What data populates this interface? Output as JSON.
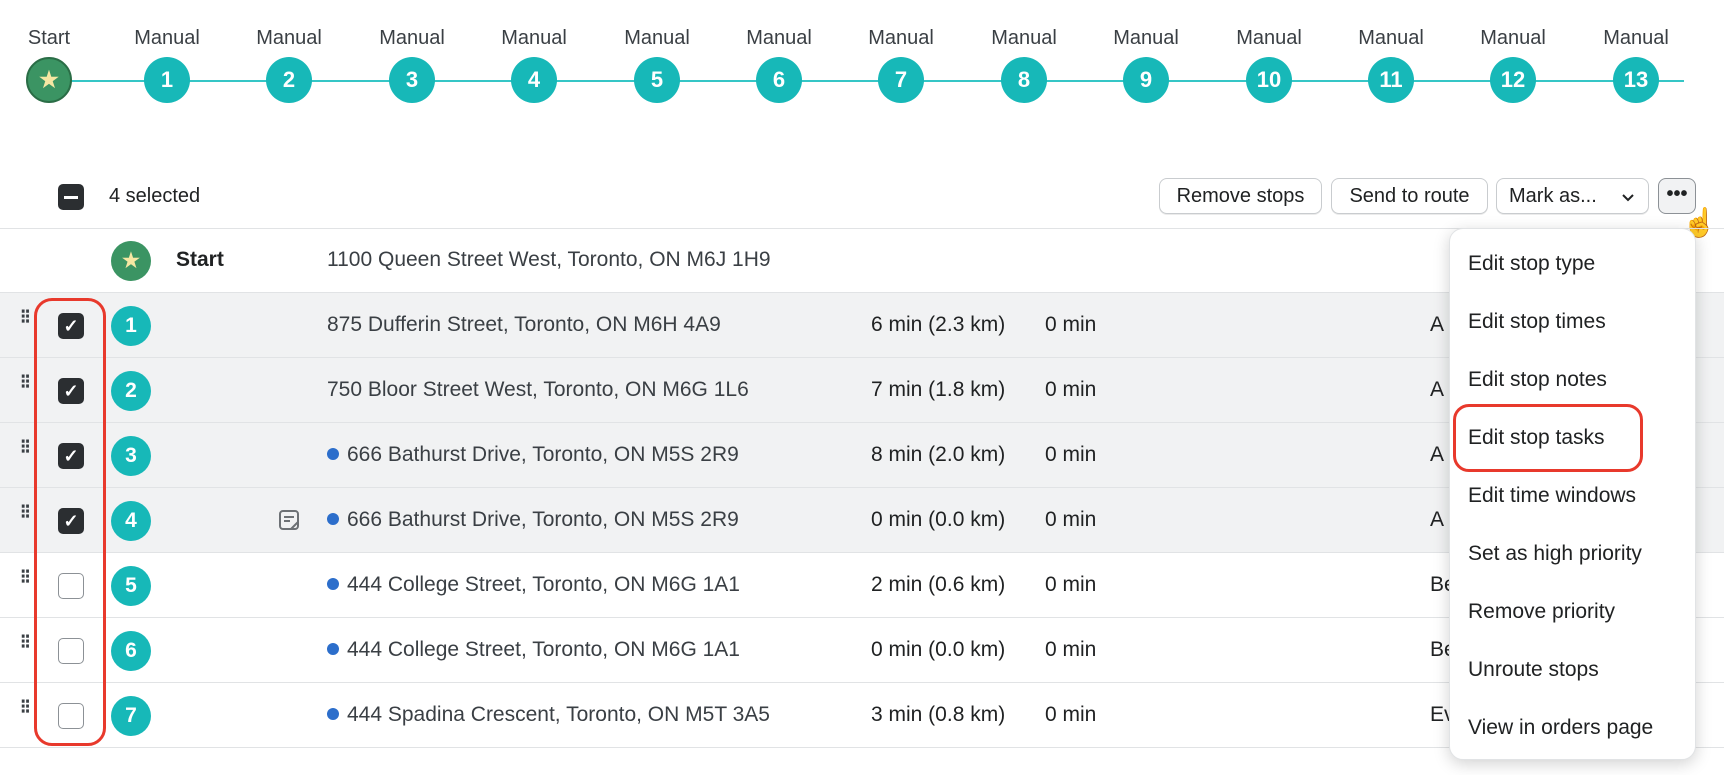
{
  "timeline": {
    "stops": [
      {
        "label": "Start",
        "marker": "star-icon",
        "kind": "start"
      },
      {
        "label": "Manual",
        "marker": "1"
      },
      {
        "label": "Manual",
        "marker": "2"
      },
      {
        "label": "Manual",
        "marker": "3"
      },
      {
        "label": "Manual",
        "marker": "4"
      },
      {
        "label": "Manual",
        "marker": "5"
      },
      {
        "label": "Manual",
        "marker": "6"
      },
      {
        "label": "Manual",
        "marker": "7"
      },
      {
        "label": "Manual",
        "marker": "8"
      },
      {
        "label": "Manual",
        "marker": "9"
      },
      {
        "label": "Manual",
        "marker": "10"
      },
      {
        "label": "Manual",
        "marker": "11"
      },
      {
        "label": "Manual",
        "marker": "12"
      },
      {
        "label": "Manual",
        "marker": "13"
      }
    ]
  },
  "toolbar": {
    "selected_count": "4 selected",
    "remove_stops": "Remove stops",
    "send_to_route": "Send to route",
    "mark_as": "Mark as...",
    "more": "•••"
  },
  "rows": [
    {
      "marker": "★",
      "name": "Start",
      "address": "1100 Queen Street West, Toronto, ON M6J 1H9",
      "travel": "",
      "service": "",
      "tail": "",
      "checked": null,
      "dot": false,
      "note": false
    },
    {
      "marker": "1",
      "name": "",
      "address": "875 Dufferin Street, Toronto, ON M6H 4A9",
      "travel": "6 min (2.3 km)",
      "service": "0 min",
      "tail": "A",
      "checked": true,
      "dot": false,
      "note": false
    },
    {
      "marker": "2",
      "name": "",
      "address": "750 Bloor Street West, Toronto, ON M6G 1L6",
      "travel": "7 min (1.8 km)",
      "service": "0 min",
      "tail": "A",
      "checked": true,
      "dot": false,
      "note": false
    },
    {
      "marker": "3",
      "name": "",
      "address": "666 Bathurst Drive, Toronto, ON M5S 2R9",
      "travel": "8 min (2.0 km)",
      "service": "0 min",
      "tail": "A",
      "checked": true,
      "dot": true,
      "note": false
    },
    {
      "marker": "4",
      "name": "",
      "address": "666 Bathurst Drive, Toronto, ON M5S 2R9",
      "travel": "0 min (0.0 km)",
      "service": "0 min",
      "tail": "A",
      "checked": true,
      "dot": true,
      "note": true
    },
    {
      "marker": "5",
      "name": "",
      "address": "444 College Street, Toronto, ON M6G 1A1",
      "travel": "2 min (0.6 km)",
      "service": "0 min",
      "tail": "Be",
      "checked": false,
      "dot": true,
      "note": false
    },
    {
      "marker": "6",
      "name": "",
      "address": "444 College Street, Toronto, ON M6G 1A1",
      "travel": "0 min (0.0 km)",
      "service": "0 min",
      "tail": "Be",
      "checked": false,
      "dot": true,
      "note": false
    },
    {
      "marker": "7",
      "name": "",
      "address": "444 Spadina Crescent, Toronto, ON M5T 3A5",
      "travel": "3 min (0.8 km)",
      "service": "0 min",
      "tail": "Ev",
      "checked": false,
      "dot": true,
      "note": false
    }
  ],
  "menu": {
    "items": [
      "Edit stop type",
      "Edit stop times",
      "Edit stop notes",
      "Edit stop tasks",
      "Edit time windows",
      "Set as high priority",
      "Remove priority",
      "Unroute stops",
      "View in orders page"
    ]
  },
  "colors": {
    "teal": "#17b8b8",
    "start_green": "#3b9463",
    "highlight_red": "#e8392c",
    "dot_blue": "#2c6ecb"
  }
}
